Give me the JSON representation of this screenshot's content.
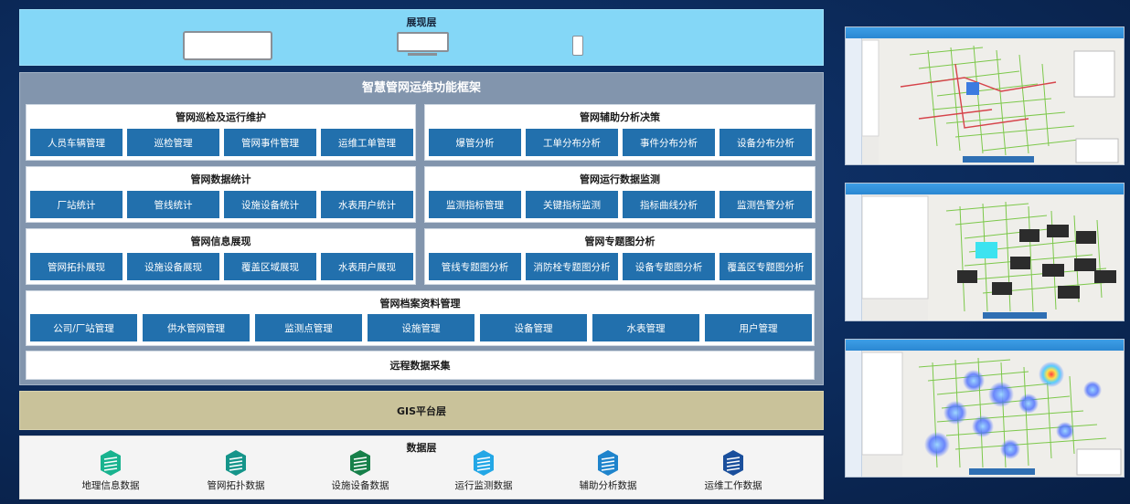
{
  "presentation": {
    "title": "展现层",
    "devices": [
      "laptop-icon",
      "monitor-icon",
      "phone-icon"
    ]
  },
  "framework": {
    "title": "智慧管网运维功能框架",
    "groups": [
      {
        "title": "管网巡检及运行维护",
        "items": [
          "人员车辆管理",
          "巡检管理",
          "管网事件管理",
          "运维工单管理"
        ]
      },
      {
        "title": "管网辅助分析决策",
        "items": [
          "爆管分析",
          "工单分布分析",
          "事件分布分析",
          "设备分布分析"
        ]
      },
      {
        "title": "管网数据统计",
        "items": [
          "厂站统计",
          "管线统计",
          "设施设备统计",
          "水表用户统计"
        ]
      },
      {
        "title": "管网运行数据监测",
        "items": [
          "监测指标管理",
          "关键指标监测",
          "指标曲线分析",
          "监测告警分析"
        ]
      },
      {
        "title": "管网信息展现",
        "items": [
          "管网拓扑展现",
          "设施设备展现",
          "覆盖区域展现",
          "水表用户展现"
        ]
      },
      {
        "title": "管网专题图分析",
        "items": [
          "管线专题图分析",
          "消防栓专题图分析",
          "设备专题图分析",
          "覆盖区专题图分析"
        ]
      }
    ],
    "archive": {
      "title": "管网档案资料管理",
      "items": [
        "公司/厂站管理",
        "供水管网管理",
        "监测点管理",
        "设施管理",
        "设备管理",
        "水表管理",
        "用户管理"
      ]
    },
    "remote": "远程数据采集"
  },
  "gis": {
    "title": "GIS平台层"
  },
  "datalayer": {
    "title": "数据层",
    "items": [
      {
        "label": "地理信息数据",
        "color": "#19b38f"
      },
      {
        "label": "管网拓扑数据",
        "color": "#15958a"
      },
      {
        "label": "设施设备数据",
        "color": "#17804a"
      },
      {
        "label": "运行监测数据",
        "color": "#23a7e6"
      },
      {
        "label": "辅助分析数据",
        "color": "#1f84cc"
      },
      {
        "label": "运维工作数据",
        "color": "#1a4f9c"
      }
    ]
  },
  "screenshots": [
    "map-screenshot-pipeline",
    "map-screenshot-labels",
    "map-screenshot-heatmap"
  ]
}
